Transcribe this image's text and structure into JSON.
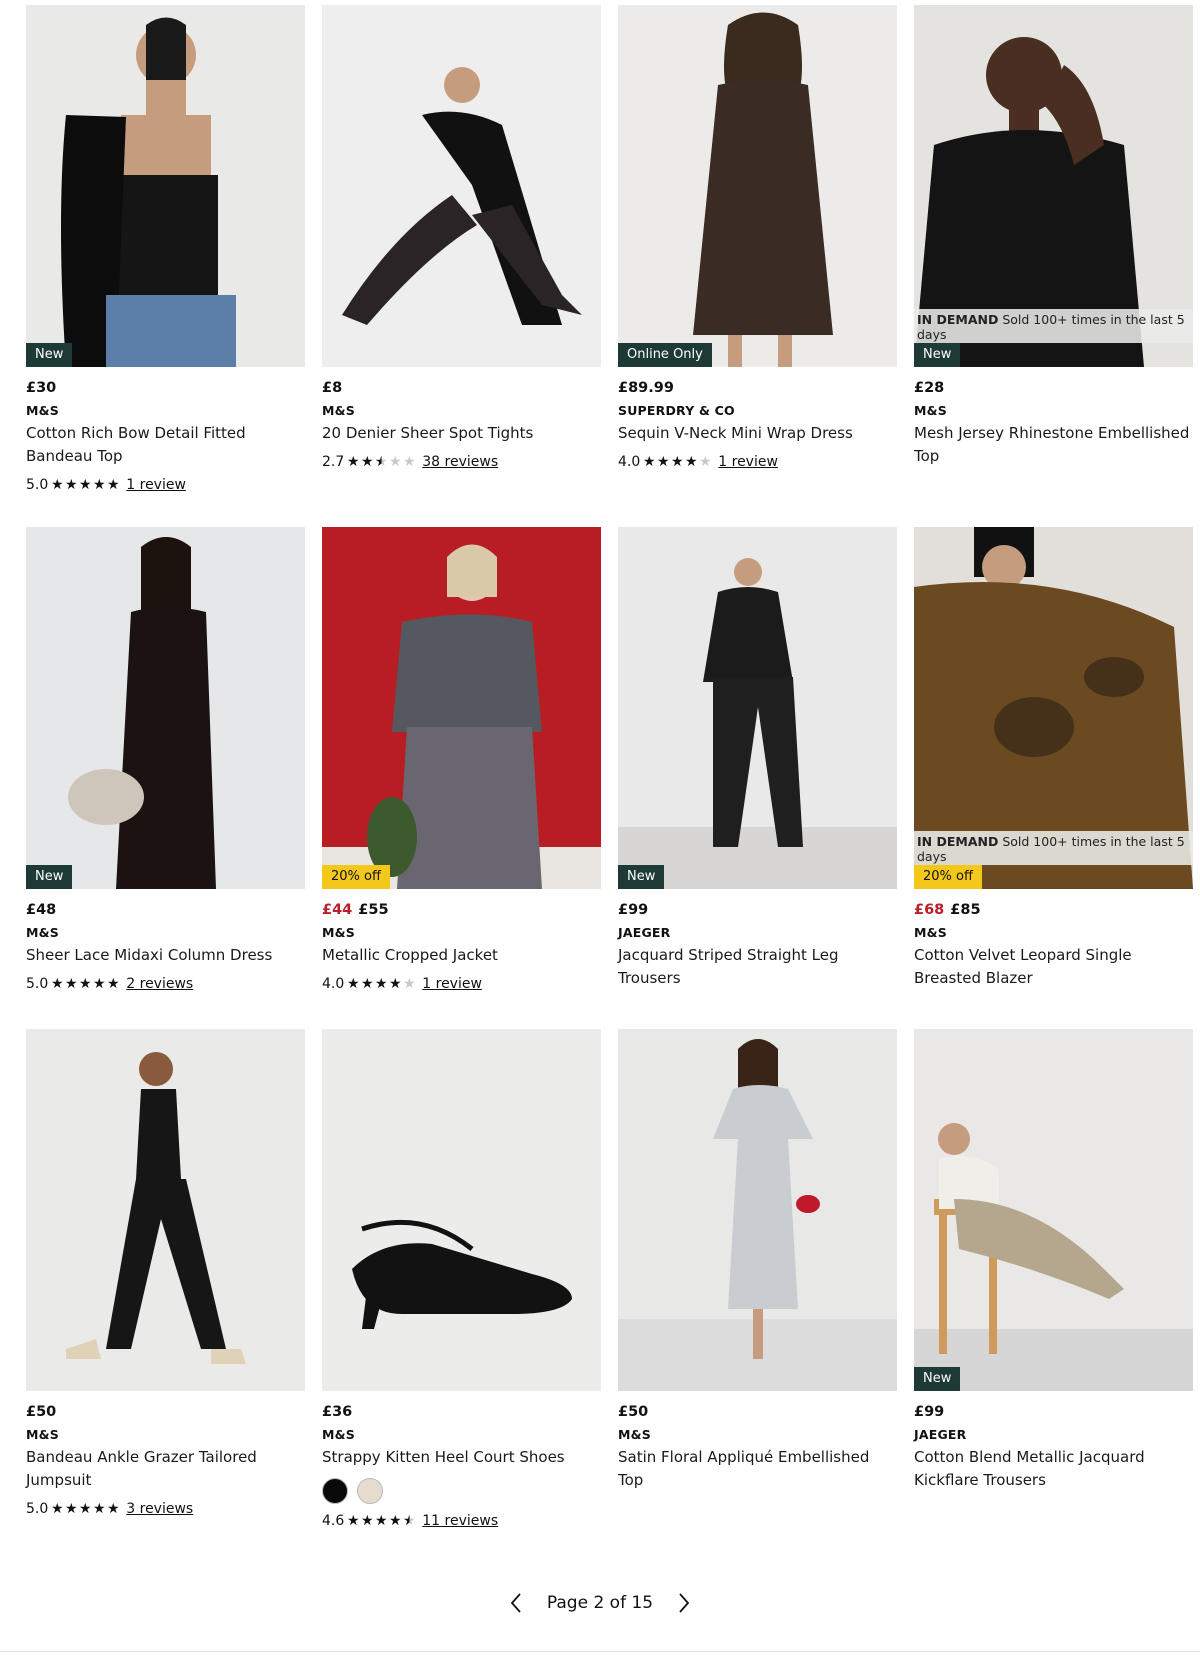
{
  "products": [
    {
      "badge": "New",
      "badge_type": "new",
      "price_now": "",
      "price_was": "",
      "price": "£30",
      "brand": "M&S",
      "title": "Cotton Rich Bow Detail Fitted Bandeau Top",
      "rating_score": "5.0",
      "stars": 5.0,
      "reviews": "1 review",
      "demand": null,
      "bg": "#e9e9e8",
      "figure": "#151515",
      "icon": "product-photo-bandeau-top"
    },
    {
      "badge": "",
      "badge_type": "",
      "price": "£8",
      "brand": "M&S",
      "title": "20 Denier Sheer Spot Tights",
      "rating_score": "2.7",
      "stars": 2.7,
      "reviews": "38 reviews",
      "demand": null,
      "bg": "#eeeeee",
      "figure": "#111111",
      "icon": "product-photo-tights"
    },
    {
      "badge": "Online Only",
      "badge_type": "online",
      "price": "£89.99",
      "brand": "SUPERDRY & CO",
      "title": "Sequin V-Neck Mini Wrap Dress",
      "rating_score": "4.0",
      "stars": 4.0,
      "reviews": "1 review",
      "demand": null,
      "bg": "#ecebea",
      "figure": "#3a2c24",
      "icon": "product-photo-sequin-dress"
    },
    {
      "badge": "New",
      "badge_type": "new",
      "price": "£28",
      "brand": "M&S",
      "title": "Mesh Jersey Rhinestone Embellished Top",
      "rating_score": "",
      "stars": null,
      "reviews": "",
      "demand": {
        "bold": "IN DEMAND",
        "text": "Sold 100+ times in the last 5 days"
      },
      "bg": "#e4e3e0",
      "figure": "#141414",
      "icon": "product-photo-rhinestone-top"
    },
    {
      "badge": "New",
      "badge_type": "new",
      "price": "£48",
      "brand": "M&S",
      "title": "Sheer Lace Midaxi Column Dress",
      "rating_score": "5.0",
      "stars": 5.0,
      "reviews": "2 reviews",
      "demand": null,
      "bg": "#e6e7e8",
      "figure": "#1a1311",
      "icon": "product-photo-lace-dress"
    },
    {
      "badge": "20% off",
      "badge_type": "sale",
      "price_now": "£44",
      "price_was": "£55",
      "price": "",
      "brand": "M&S",
      "title": "Metallic Cropped Jacket",
      "rating_score": "4.0",
      "stars": 4.0,
      "reviews": "1 review",
      "demand": null,
      "bg": "#b81d24",
      "figure": "#56585f",
      "icon": "product-photo-cropped-jacket"
    },
    {
      "badge": "New",
      "badge_type": "new",
      "price": "£99",
      "brand": "JAEGER",
      "title": "Jacquard Striped Straight Leg Trousers",
      "rating_score": "",
      "stars": null,
      "reviews": "",
      "demand": null,
      "bg": "#e9e9e9",
      "figure": "#1b1b1b",
      "icon": "product-photo-striped-trousers"
    },
    {
      "badge": "20% off",
      "badge_type": "sale",
      "price_now": "£68",
      "price_was": "£85",
      "price": "",
      "brand": "M&S",
      "title": "Cotton Velvet Leopard Single Breasted Blazer",
      "rating_score": "",
      "stars": null,
      "reviews": "",
      "demand": {
        "bold": "IN DEMAND",
        "text": "Sold 100+ times in the last 5 days"
      },
      "bg": "#e2dfda",
      "figure": "#6b4a22",
      "icon": "product-photo-leopard-blazer"
    },
    {
      "badge": "",
      "badge_type": "",
      "price": "£50",
      "brand": "M&S",
      "title": "Bandeau Ankle Grazer Tailored Jumpsuit",
      "rating_score": "5.0",
      "stars": 5.0,
      "reviews": "3 reviews",
      "demand": null,
      "bg": "#eaeae9",
      "figure": "#161616",
      "icon": "product-photo-jumpsuit"
    },
    {
      "badge": "",
      "badge_type": "",
      "price": "£36",
      "brand": "M&S",
      "title": "Strappy Kitten Heel Court Shoes",
      "rating_score": "4.6",
      "stars": 4.6,
      "reviews": "11 reviews",
      "demand": null,
      "bg": "#ececeb",
      "figure": "#121212",
      "icon": "product-photo-kitten-heels",
      "swatches": [
        "#0a0a0a",
        "#e6dccd"
      ]
    },
    {
      "badge": "",
      "badge_type": "",
      "price": "£50",
      "brand": "M&S",
      "title": "Satin Floral Appliqué Embellished Top",
      "rating_score": "",
      "stars": null,
      "reviews": "",
      "demand": null,
      "bg": "#e8e8e7",
      "figure": "#c9ccd0",
      "icon": "product-photo-floral-top"
    },
    {
      "badge": "New",
      "badge_type": "new",
      "price": "£99",
      "brand": "JAEGER",
      "title": "Cotton Blend Metallic Jacquard Kickflare Trousers",
      "rating_score": "",
      "stars": null,
      "reviews": "",
      "demand": null,
      "bg": "#e9e8e6",
      "figure": "#b5a78e",
      "icon": "product-photo-kickflare-trousers"
    }
  ],
  "pagination": {
    "label": "Page 2 of 15",
    "prev_icon": "chevron-left-icon",
    "next_icon": "chevron-right-icon"
  }
}
